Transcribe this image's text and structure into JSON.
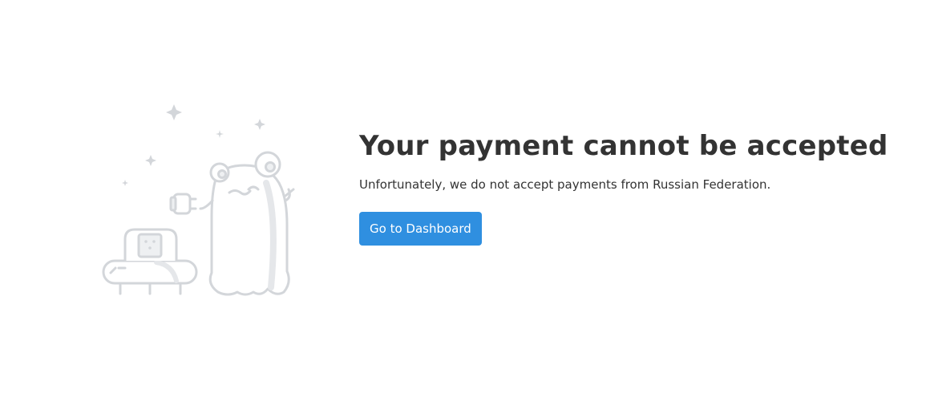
{
  "error": {
    "title": "Your payment cannot be accepted",
    "message": "Unfortunately, we do not accept payments from Russian Federation.",
    "button_label": "Go to Dashboard"
  },
  "colors": {
    "title_text": "#333333",
    "button_bg": "#2f8fe0",
    "button_text": "#ffffff",
    "illustration_stroke": "#d3d6da",
    "illustration_fill": "#eef0f2"
  },
  "icons": {
    "illustration": "alien-with-ufo-illustration"
  }
}
